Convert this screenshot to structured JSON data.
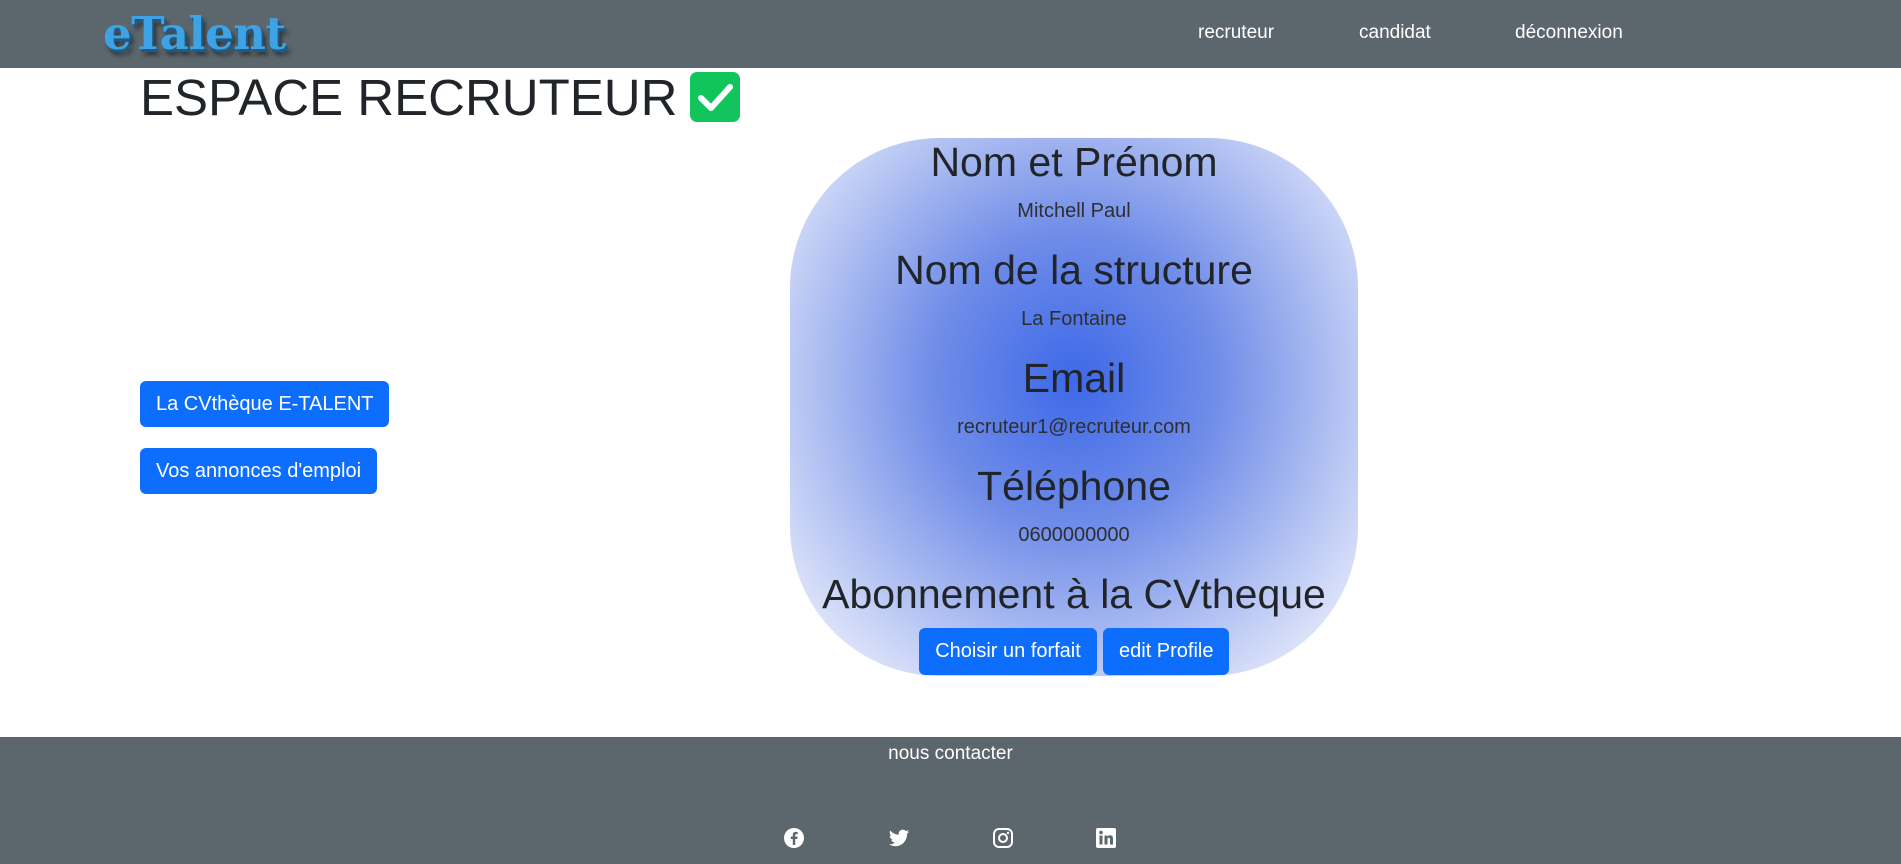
{
  "navbar": {
    "brand": "eTalent",
    "links": [
      {
        "label": "recruteur"
      },
      {
        "label": "candidat"
      },
      {
        "label": "déconnexion"
      }
    ]
  },
  "page": {
    "title": "ESPACE RECRUTEUR",
    "title_icon": "check-box-icon"
  },
  "sidebar": {
    "buttons": [
      {
        "label": "La CVthèque E-TALENT"
      },
      {
        "label": "Vos annonces d'emploi"
      }
    ]
  },
  "profile": {
    "name_heading": "Nom et Prénom",
    "name_value": "Mitchell Paul",
    "structure_heading": "Nom de la structure",
    "structure_value": "La Fontaine",
    "email_heading": "Email",
    "email_value": "recruteur1@recruteur.com",
    "phone_heading": "Téléphone",
    "phone_value": "0600000000",
    "subscription_heading": "Abonnement à la CVtheque",
    "choose_plan_label": "Choisir un forfait",
    "edit_profile_label": "edit Profile"
  },
  "footer": {
    "contact_label": "nous contacter",
    "social_icons": [
      "facebook-icon",
      "twitter-icon",
      "instagram-icon",
      "linkedin-icon"
    ]
  },
  "colors": {
    "navbar_bg": "#5c676d",
    "primary_button": "#0d6efd",
    "check_green": "#12c45c",
    "brand_blue": "#3ea3e5"
  }
}
